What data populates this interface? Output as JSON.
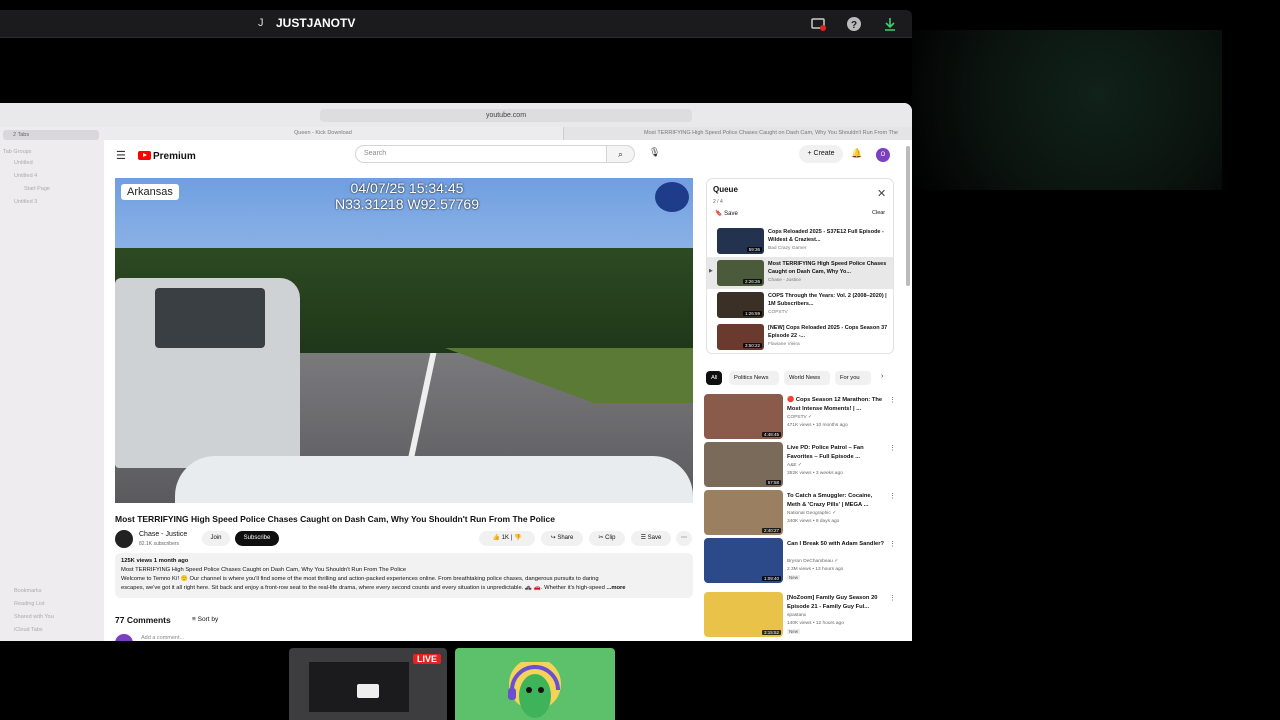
{
  "topbar": {
    "initial": "J",
    "title": "JUSTJANOTV"
  },
  "browser": {
    "url": "youtube.com",
    "tab_active": "Queen - Kick Download",
    "tab_other": "Most TERRIFYING High Speed Police Chases Caught on Dash Cam, Why You Shouldn't Run From The Police",
    "sidebar_tabs": "2 Tabs",
    "tab_groups": "Tab Groups",
    "groups": [
      "Untitled",
      "Untitled 4",
      "Start Page",
      "Untitled 3"
    ],
    "bottom_links": [
      "Bookmarks",
      "Reading List",
      "Shared with You",
      "iCloud Tabs"
    ]
  },
  "youtube": {
    "logo": "Premium",
    "search_placeholder": "Search",
    "create": "Create",
    "avatar": "O"
  },
  "player": {
    "location": "Arkansas",
    "date": "04/07/25 15:34:45",
    "coords": "N33.31218 W92.57769"
  },
  "video": {
    "title": "Most TERRIFYING High Speed Police Chases Caught on Dash Cam, Why You Shouldn't Run From The Police",
    "channel": "Chase - Justice",
    "subscribers": "82.1K subscribers",
    "join": "Join",
    "subscribe": "Subscribe",
    "likes": "1K",
    "share": "Share",
    "clip": "Clip",
    "save": "Save",
    "views": "125K views  1 month ago",
    "desc1": "Most TERRIFYING High Speed Police Chases Caught on Dash Cam, Why You Shouldn't Run From The Police",
    "desc2": "Welcome to Temno Kí! 🙂 Our channel is where you'll find some of the most thrilling and action-packed experiences online. From breathtaking police chases, dangerous pursuits to daring",
    "desc3": "escapes, we've got it all right here. Sit back and enjoy a front-row seat to the real-life drama, where every second counts and every situation is unpredictable. 🚓 🚗. Whether it's high-speed",
    "more": "...more",
    "comments": "77 Comments",
    "sort": "Sort by",
    "add_comment": "Add a comment..."
  },
  "queue": {
    "title": "Queue",
    "count": "2 / 4",
    "save": "Save",
    "clear": "Clear",
    "items": [
      {
        "title": "Cops Reloaded 2025 - S37E12 Full Episode - Wildest & Craziest...",
        "channel": "Bad Crazy Gamer",
        "duration": "59:36"
      },
      {
        "title": "Most TERRIFYING High Speed Police Chases Caught on Dash Cam, Why Yo...",
        "channel": "Chase - Justice",
        "duration": "2:26:26"
      },
      {
        "title": "COPS Through the Years: Vol. 2 (2008–2020) | 1M Subscribers...",
        "channel": "COPSTV",
        "duration": "1:26:59"
      },
      {
        "title": "[NEW] Cops Reloaded 2025 - Cops Season 37 Episode 22 -...",
        "channel": "Flaviane Vieira",
        "duration": "3:50:22"
      }
    ]
  },
  "chips": [
    "All",
    "Politics News",
    "World News",
    "For you"
  ],
  "recs": [
    {
      "title": "🔴 Cops Season 12 Marathon: The Most Intense Moments! | ...",
      "channel": "COPSTV ✓",
      "meta": "471K views • 10 months ago",
      "duration": "4:48:45",
      "new": ""
    },
    {
      "title": "Live PD: Police Patrol – Fan Favorites – Full Episode ...",
      "channel": "A&E ✓",
      "meta": "352K views • 3 weeks ago",
      "duration": "57:58",
      "new": ""
    },
    {
      "title": "To Catch a Smuggler: Cocaine, Meth & 'Crazy Pills' | MEGA ...",
      "channel": "National Geographic ✓",
      "meta": "340K views • 8 days ago",
      "duration": "2:40:27",
      "new": ""
    },
    {
      "title": "Can I Break 50 with Adam Sandler?",
      "channel": "Bryson DeChambeau ✓",
      "meta": "2.3M views • 13 hours ago",
      "duration": "1:09:40",
      "new": "New"
    },
    {
      "title": "[NoZoom] Family Guy Season 20 Episode 21 - Family Guy Ful...",
      "channel": "spastanx",
      "meta": "140K views • 12 hours ago",
      "duration": "3:15:52",
      "new": "New"
    }
  ],
  "dock": {
    "live": "LIVE"
  },
  "colors": {
    "youtube_red": "#ff0000",
    "live_red": "#e52222",
    "tile_green": "#5dc06a"
  }
}
